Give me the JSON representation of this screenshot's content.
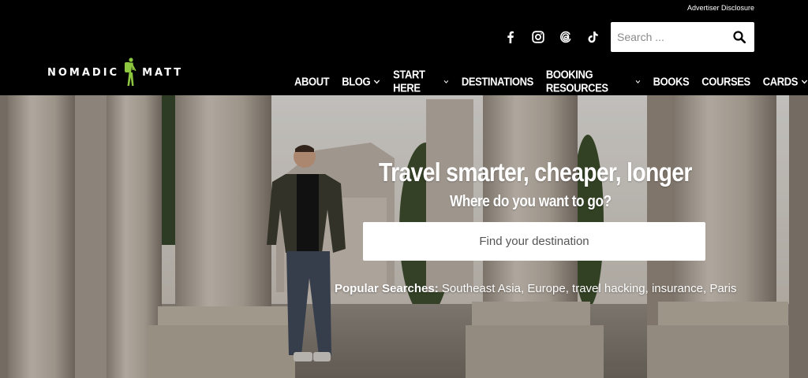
{
  "header": {
    "advertiser_disclosure": "Advertiser Disclosure",
    "social_icons": [
      "facebook-icon",
      "instagram-icon",
      "threads-icon",
      "tiktok-icon"
    ],
    "search_placeholder": "Search ...",
    "logo": {
      "left": "NOMADIC",
      "right": "MATT"
    },
    "nav": [
      {
        "label": "ABOUT",
        "dropdown": false
      },
      {
        "label": "BLOG",
        "dropdown": true
      },
      {
        "label": "START HERE",
        "dropdown": true
      },
      {
        "label": "DESTINATIONS",
        "dropdown": false
      },
      {
        "label": "BOOKING RESOURCES",
        "dropdown": true
      },
      {
        "label": "BOOKS",
        "dropdown": false
      },
      {
        "label": "COURSES",
        "dropdown": false
      },
      {
        "label": "CARDS",
        "dropdown": true
      }
    ]
  },
  "hero": {
    "title": "Travel smarter, cheaper, longer",
    "subtitle": "Where do you want to go?",
    "destination_placeholder": "Find your destination",
    "popular_label": "Popular Searches:",
    "popular": [
      "Southeast Asia",
      "Europe",
      "travel hacking",
      "insurance",
      "Paris"
    ]
  },
  "colors": {
    "header_bg": "#000000",
    "logo_accent": "#8dc63f",
    "text": "#ffffff"
  }
}
